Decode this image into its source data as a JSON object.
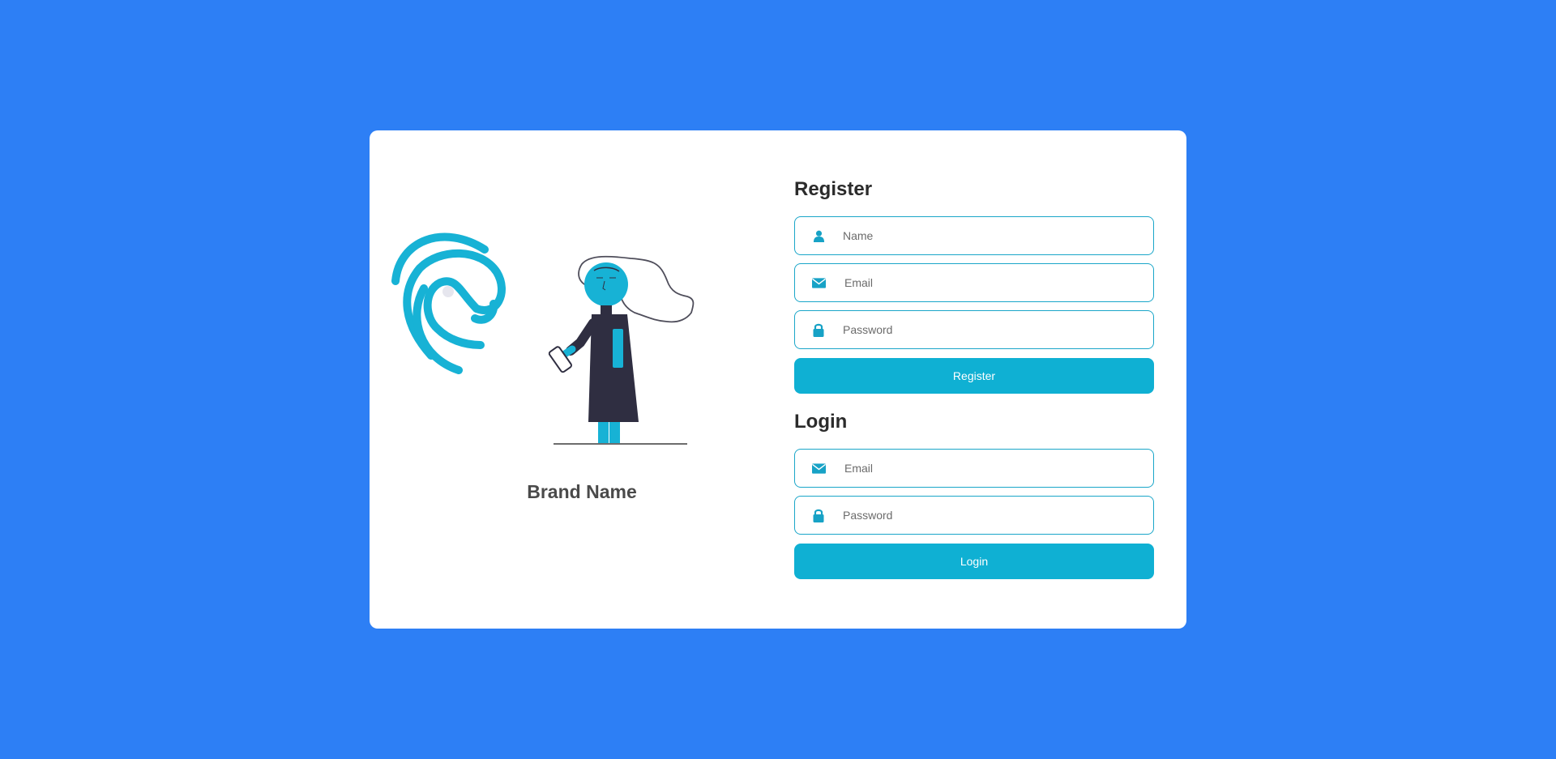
{
  "brand": {
    "name": "Brand Name"
  },
  "register": {
    "title": "Register",
    "name_placeholder": "Name",
    "email_placeholder": "Email",
    "password_placeholder": "Password",
    "button_label": "Register"
  },
  "login": {
    "title": "Login",
    "email_placeholder": "Email",
    "password_placeholder": "Password",
    "button_label": "Login"
  },
  "icons": {
    "name": "user-icon",
    "email": "envelope-icon",
    "password": "lock-icon",
    "logo": "fingerprint-logo"
  },
  "colors": {
    "background": "#2d7ff5",
    "accent": "#0fb0d3",
    "card": "#ffffff",
    "figure_dark": "#2f2e41"
  }
}
